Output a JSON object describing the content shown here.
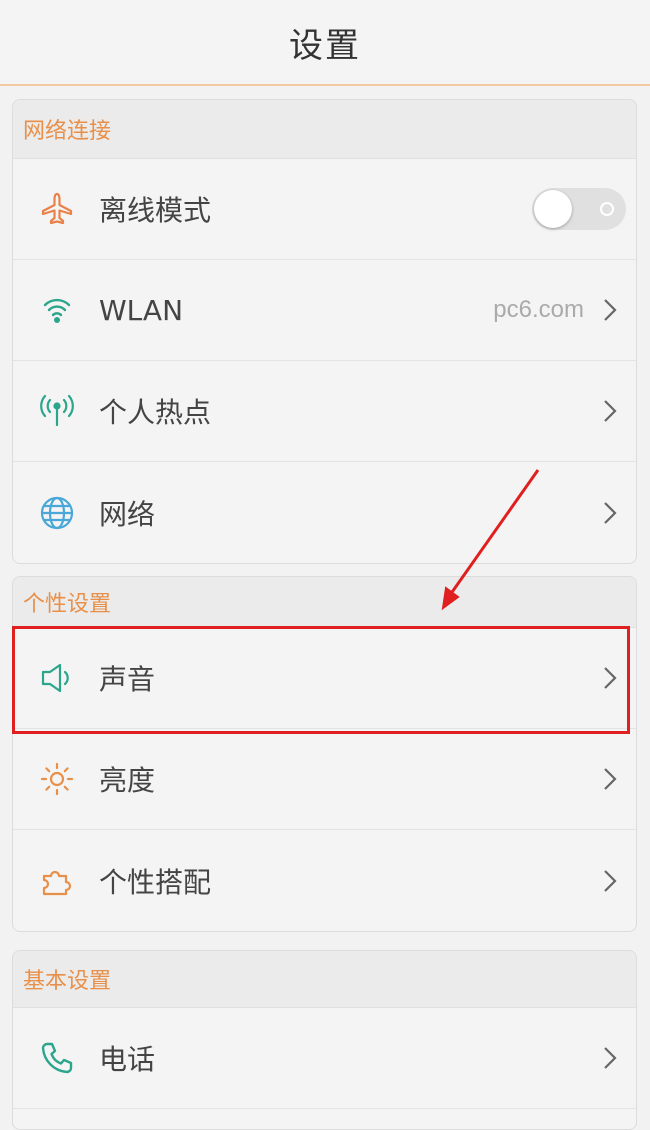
{
  "header": {
    "title": "设置"
  },
  "sections": [
    {
      "title": "网络连接",
      "items": [
        {
          "label": "离线模式",
          "icon": "airplane-icon",
          "toggle": "off"
        },
        {
          "label": "WLAN",
          "icon": "wifi-icon",
          "value": "pc6.com"
        },
        {
          "label": "个人热点",
          "icon": "hotspot-icon"
        },
        {
          "label": "网络",
          "icon": "globe-icon"
        }
      ]
    },
    {
      "title": "个性设置",
      "items": [
        {
          "label": "声音",
          "icon": "speaker-icon",
          "highlighted": true
        },
        {
          "label": "亮度",
          "icon": "sun-icon"
        },
        {
          "label": "个性搭配",
          "icon": "puzzle-icon"
        }
      ]
    },
    {
      "title": "基本设置",
      "items": [
        {
          "label": "电话",
          "icon": "phone-icon"
        }
      ]
    }
  ],
  "colors": {
    "section_title": "#e8904a",
    "icon_orange": "#e8824a",
    "icon_teal": "#2ba58c",
    "icon_blue": "#4aa8d8",
    "highlight": "#e02020"
  }
}
